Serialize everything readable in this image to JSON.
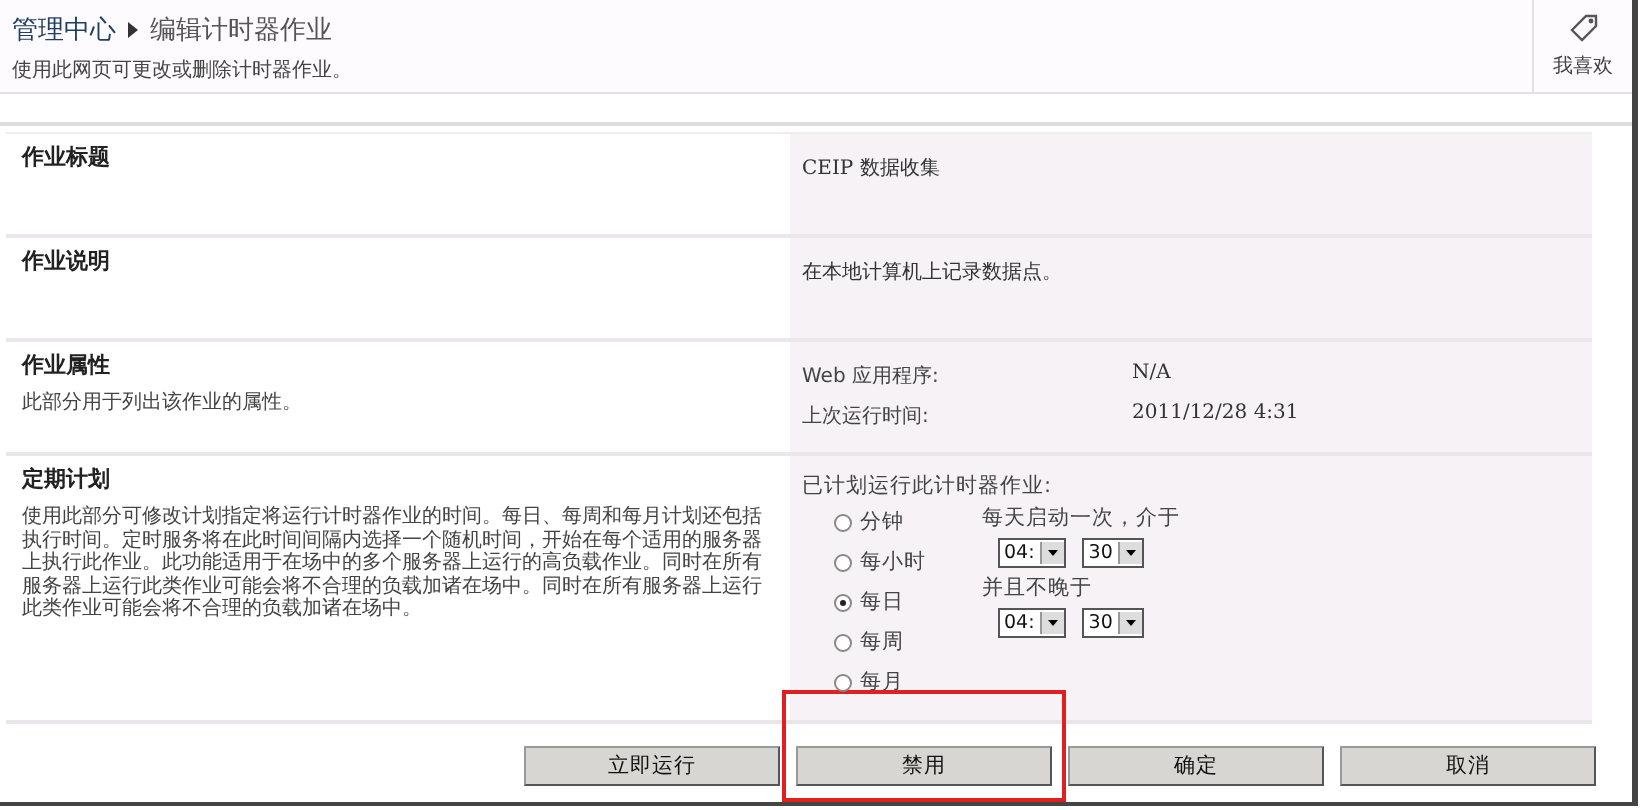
{
  "header": {
    "breadcrumb": [
      {
        "label": "管理中心"
      },
      {
        "label": "编辑计时器作业"
      }
    ],
    "subtitle": "使用此网页可更改或删除计时器作业。",
    "like_button": "我喜欢"
  },
  "sections": [
    {
      "kind": "text",
      "title": "作业标题",
      "value": "CEIP 数据收集"
    },
    {
      "kind": "text",
      "title": "作业说明",
      "value": "在本地计算机上记录数据点。"
    },
    {
      "kind": "properties",
      "title": "作业属性",
      "description": "此部分用于列出该作业的属性。",
      "properties": [
        {
          "label": "Web 应用程序:",
          "value": "N/A"
        },
        {
          "label": "上次运行时间:",
          "value": "2011/12/28 4:31"
        }
      ]
    },
    {
      "kind": "schedule",
      "title": "定期计划",
      "description": "使用此部分可修改计划指定将运行计时器作业的时间。每日、每周和每月计划还包括执行时间。定时服务将在此时间间隔内选择一个随机时间，开始在每个适用的服务器上执行此作业。此功能适用于在场中的多个服务器上运行的高负载作业。同时在所有服务器上运行此类作业可能会将不合理的负载加诸在场中。同时在所有服务器上运行此类作业可能会将不合理的负载加诸在场中。",
      "schedule": {
        "label": "已计划运行此计时器作业:",
        "options": [
          {
            "label": "分钟",
            "selected": false
          },
          {
            "label": "每小时",
            "selected": false
          },
          {
            "label": "每日",
            "selected": true
          },
          {
            "label": "每周",
            "selected": false
          },
          {
            "label": "每月",
            "selected": false
          }
        ],
        "start_label": "每天启动一次，介于",
        "start": {
          "hour": "04:",
          "minute": "30"
        },
        "end_label": "并且不晚于",
        "end": {
          "hour": "04:",
          "minute": "30"
        }
      }
    }
  ],
  "buttons": [
    {
      "label": "立即运行",
      "highlighted": false
    },
    {
      "label": "禁用",
      "highlighted": true
    },
    {
      "label": "确定",
      "highlighted": false
    },
    {
      "label": "取消",
      "highlighted": false
    }
  ]
}
